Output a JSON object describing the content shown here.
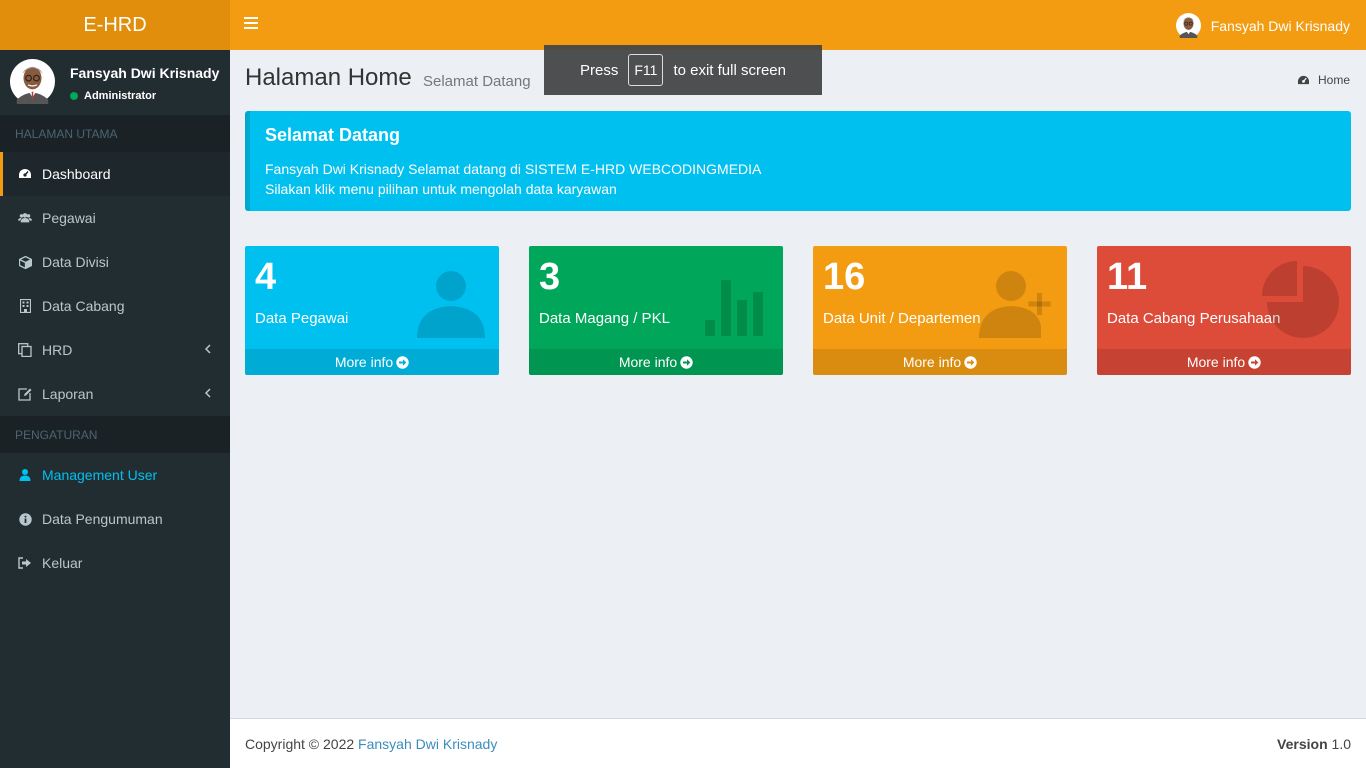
{
  "header": {
    "logo": "E-HRD",
    "user_name": "Fansyah Dwi Krisnady"
  },
  "sidebar": {
    "user_name": "Fansyah Dwi Krisnady",
    "user_role": "Administrator",
    "section_main": "HALAMAN UTAMA",
    "section_settings": "PENGATURAN",
    "items": [
      {
        "label": "Dashboard",
        "icon": "dashboard-icon"
      },
      {
        "label": "Pegawai",
        "icon": "users-icon"
      },
      {
        "label": "Data Divisi",
        "icon": "cube-icon"
      },
      {
        "label": "Data Cabang",
        "icon": "building-icon"
      },
      {
        "label": "HRD",
        "icon": "copy-icon"
      },
      {
        "label": "Laporan",
        "icon": "edit-icon"
      },
      {
        "label": "Management User",
        "icon": "user-icon"
      },
      {
        "label": "Data Pengumuman",
        "icon": "info-icon"
      },
      {
        "label": "Keluar",
        "icon": "sign-out-icon"
      }
    ]
  },
  "content": {
    "title": "Halaman Home",
    "subtitle": "Selamat Datang",
    "breadcrumb": "Home"
  },
  "fullscreen_toast": {
    "press": "Press",
    "key": "F11",
    "rest": "to exit full screen"
  },
  "callout": {
    "title": "Selamat Datang",
    "line1": "Fansyah Dwi Krisnady Selamat datang di SISTEM E-HRD WEBCODINGMEDIA",
    "line2": "Silakan klik menu pilihan untuk mengolah data karyawan"
  },
  "boxes": [
    {
      "value": "4",
      "label": "Data Pegawai",
      "more": "More info",
      "color": "#00c0ef"
    },
    {
      "value": "3",
      "label": "Data Magang / PKL",
      "more": "More info",
      "color": "#00a65a"
    },
    {
      "value": "16",
      "label": "Data Unit / Departemen",
      "more": "More info",
      "color": "#f39c12"
    },
    {
      "value": "11",
      "label": "Data Cabang Perusahaan",
      "more": "More info",
      "color": "#dd4b39"
    }
  ],
  "footer": {
    "copyright": "Copyright © 2022",
    "author": "Fansyah Dwi Krisnady",
    "version_label": "Version",
    "version": "1.0"
  }
}
